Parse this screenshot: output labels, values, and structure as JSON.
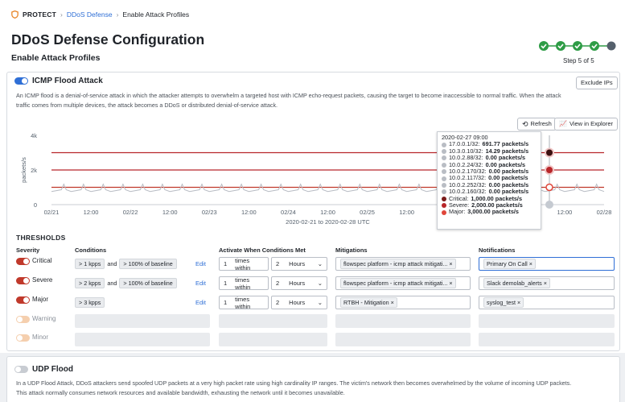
{
  "breadcrumb": {
    "app": "PROTECT",
    "link": "DDoS Defense",
    "current": "Enable Attack Profiles"
  },
  "page": {
    "title": "DDoS Defense Configuration",
    "subtitle": "Enable Attack Profiles",
    "step_label": "Step 5 of 5"
  },
  "icmp": {
    "title": "ICMP Flood Attack",
    "exclude_label": "Exclude IPs",
    "desc1": "An ICMP flood is a denial-of-service attack in which the attacker attempts to overwhelm a targeted host with ICMP echo-request packets, causing the target to become inaccessible to normal traffic. When the attack",
    "desc2": "traffic comes from multiple devices, the attack becomes a DDoS or distributed denial-of-service attack.",
    "refresh_label": "Refresh",
    "explorer_label": "View in Explorer"
  },
  "chart_data": {
    "type": "line",
    "ylabel": "packets/s",
    "yticks": [
      "0",
      "2k",
      "4k"
    ],
    "ylim": [
      0,
      4000
    ],
    "xticks": [
      "02/21",
      "12:00",
      "02/22",
      "12:00",
      "02/23",
      "12:00",
      "02/24",
      "12:00",
      "02/25",
      "12:00",
      "02/26",
      "12:00",
      "02/27",
      "12:00",
      "02/28"
    ],
    "xlabel": "2020-02-21 to 2020-02-28 UTC",
    "thresholds": [
      {
        "name": "Critical",
        "value": 3000,
        "color": "#b8262a"
      },
      {
        "name": "Severe",
        "value": 2000,
        "color": "#b8262a"
      },
      {
        "name": "Major",
        "value": 1000,
        "color": "#c0392b"
      }
    ],
    "traffic_baseline": 800
  },
  "tooltip": {
    "time": "2020-02-27 09:00",
    "rows": [
      {
        "label": "17.0.0.1/32:",
        "value": "691.77 packets/s",
        "color": "#b9bdc4"
      },
      {
        "label": "10.3.0.10/32:",
        "value": "14.29 packets/s",
        "color": "#b9bdc4"
      },
      {
        "label": "10.0.2.88/32:",
        "value": "0.00 packets/s",
        "color": "#b9bdc4"
      },
      {
        "label": "10.0.2.24/32:",
        "value": "0.00 packets/s",
        "color": "#b9bdc4"
      },
      {
        "label": "10.0.2.170/32:",
        "value": "0.00 packets/s",
        "color": "#b9bdc4"
      },
      {
        "label": "10.0.2.117/32:",
        "value": "0.00 packets/s",
        "color": "#b9bdc4"
      },
      {
        "label": "10.0.2.252/32:",
        "value": "0.00 packets/s",
        "color": "#b9bdc4"
      },
      {
        "label": "10.0.2.160/32:",
        "value": "0.00 packets/s",
        "color": "#b9bdc4"
      },
      {
        "label": "Critical:",
        "value": "1,000.00 packets/s",
        "color": "#7a1b1b"
      },
      {
        "label": "Severe:",
        "value": "2,000.00 packets/s",
        "color": "#b8262a"
      },
      {
        "label": "Major:",
        "value": "3,000.00 packets/s",
        "color": "#e0453a"
      }
    ]
  },
  "thresholds": {
    "title": "THRESHOLDS",
    "headers": {
      "severity": "Severity",
      "conditions": "Conditions",
      "activate": "Activate When Conditions Met",
      "mitigations": "Mitigations",
      "notifications": "Notifications"
    },
    "rows": [
      {
        "severity": "Critical",
        "c1": "> 1 kpps",
        "and": "and",
        "c2": "> 100% of baseline",
        "edit": "Edit",
        "times": "1",
        "within": "times within",
        "count": "2",
        "unit": "Hours",
        "mitigation": "flowspec platform - icmp attack mitigati...",
        "notification": "Primary On Call"
      },
      {
        "severity": "Severe",
        "c1": "> 2 kpps",
        "and": "and",
        "c2": "> 100% of baseline",
        "edit": "Edit",
        "times": "1",
        "within": "times within",
        "count": "2",
        "unit": "Hours",
        "mitigation": "flowspec platform - icmp attack mitigati...",
        "notification": "Slack demolab_alerts"
      },
      {
        "severity": "Major",
        "c1": "> 3 kpps",
        "edit": "Edit",
        "times": "1",
        "within": "times within",
        "count": "2",
        "unit": "Hours",
        "mitigation": "RTBH - Mitigation",
        "notification": "syslog_test"
      },
      {
        "severity": "Warning"
      },
      {
        "severity": "Minor"
      }
    ]
  },
  "udp": {
    "title": "UDP Flood",
    "desc1": "In a UDP Flood Attack, DDoS attackers send spoofed UDP packets at a very high packet rate using high cardinality IP ranges. The victim's network then becomes overwhelmed by the volume of incoming UDP packets.",
    "desc2": "This attack normally consumes network resources and available bandwidth, exhausting the network until it becomes unavailable."
  }
}
